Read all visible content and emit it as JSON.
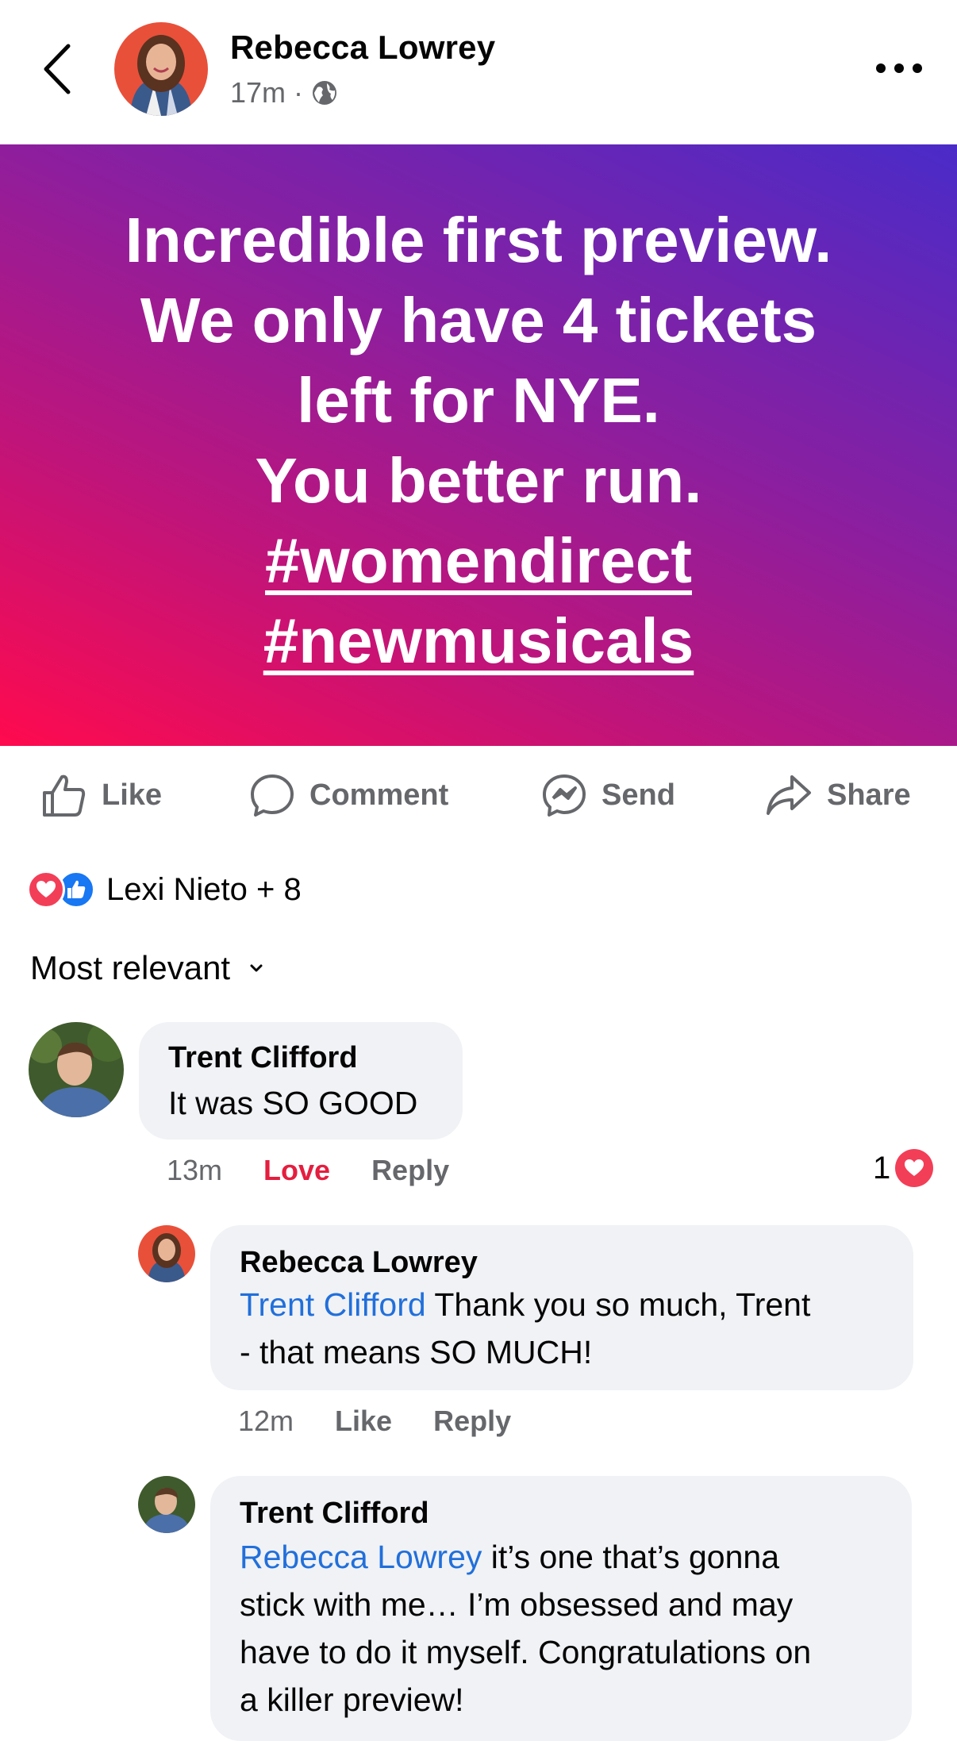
{
  "header": {
    "author": "Rebecca Lowrey",
    "time": "17m",
    "separator": "·",
    "privacy_icon": "globe-icon",
    "back_icon": "chevron-left-icon",
    "more_icon": "more-horizontal-icon"
  },
  "post": {
    "lines": [
      "Incredible first preview.",
      "We only have 4 tickets",
      "left for NYE.",
      "You better run."
    ],
    "hashtags": [
      "#womendirect",
      "#newmusicals"
    ],
    "gradient_colors": [
      "#ff0a4e",
      "#c0147a",
      "#8a1fa0",
      "#4a2bc8"
    ]
  },
  "actions": {
    "like": "Like",
    "comment": "Comment",
    "send": "Send",
    "share": "Share"
  },
  "reactions": {
    "summary": "Lexi Nieto + 8",
    "types": [
      "love",
      "like"
    ]
  },
  "sort": {
    "label": "Most relevant"
  },
  "comments": [
    {
      "author": "Trent Clifford",
      "text": "It was SO GOOD",
      "time": "13m",
      "reaction_label": "Love",
      "reply_label": "Reply",
      "reaction_count": "1",
      "replies": [
        {
          "author": "Rebecca Lowrey",
          "mention": "Trent Clifford",
          "text_line1": " Thank you so much, Trent",
          "text_line2": "- that means SO MUCH!",
          "time": "12m",
          "like_label": "Like",
          "reply_label": "Reply"
        },
        {
          "author": "Trent Clifford",
          "mention": "Rebecca Lowrey",
          "text_line1": " it’s one that’s gonna",
          "text_line2": "stick with me… I’m obsessed and may",
          "text_line3": "have to do it myself. Congratulations on",
          "text_line4": "a killer preview!"
        }
      ]
    }
  ],
  "colors": {
    "mention": "#216fdb",
    "love": "#e41e3f",
    "like_blue": "#1877f2",
    "bubble": "#f0f2f5",
    "muted": "#65676b"
  }
}
